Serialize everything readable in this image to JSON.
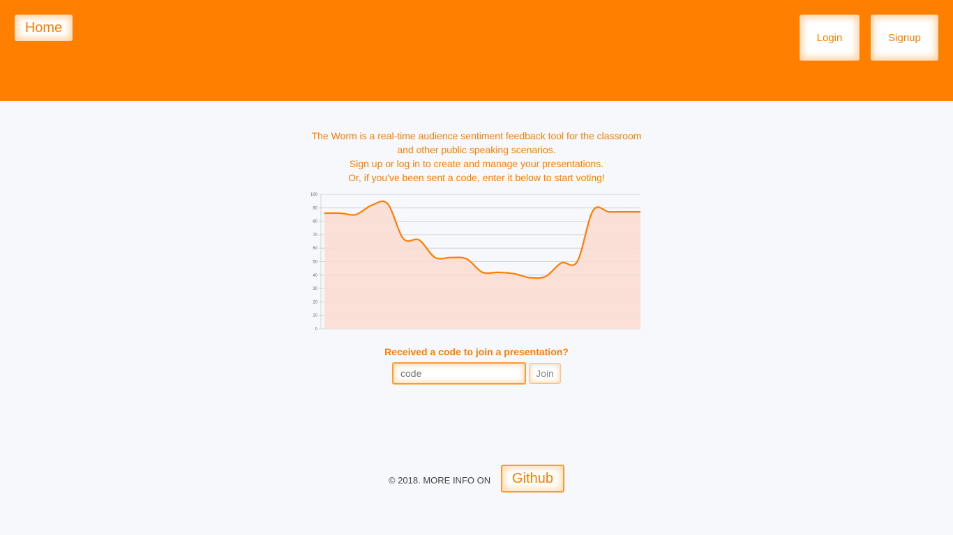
{
  "header": {
    "home_label": "Home",
    "login_label": "Login",
    "signup_label": "Signup",
    "bg_color": "#ff8000",
    "accent_color": "#ff7d00"
  },
  "intro": {
    "line1": "The Worm is a real-time audience sentiment feedback tool for the classroom",
    "line2": "and other public speaking scenarios.",
    "line3": "Sign up or log in to create and manage your presentations.",
    "line4": "Or, if you've been sent a code, enter it below to start voting!"
  },
  "chart_data": {
    "type": "area",
    "title": "",
    "xlabel": "",
    "ylabel": "",
    "ylim": [
      0,
      100
    ],
    "yticks": [
      0,
      10,
      20,
      30,
      40,
      50,
      60,
      70,
      80,
      90,
      100
    ],
    "grid": true,
    "legend": "none",
    "line_color": "#ff7d00",
    "fill_color": "#f9ddd3",
    "series": [
      {
        "values": [
          86,
          86,
          85,
          92,
          93,
          67,
          66,
          53,
          53,
          52,
          42,
          42,
          41,
          38,
          39,
          49,
          50,
          88,
          87,
          87,
          87
        ]
      }
    ]
  },
  "join": {
    "label": "Received a code to join a presentation?",
    "placeholder": "code",
    "value": "",
    "button_label": "Join"
  },
  "footer": {
    "text": "© 2018. MORE INFO ON",
    "github_label": "Github"
  }
}
